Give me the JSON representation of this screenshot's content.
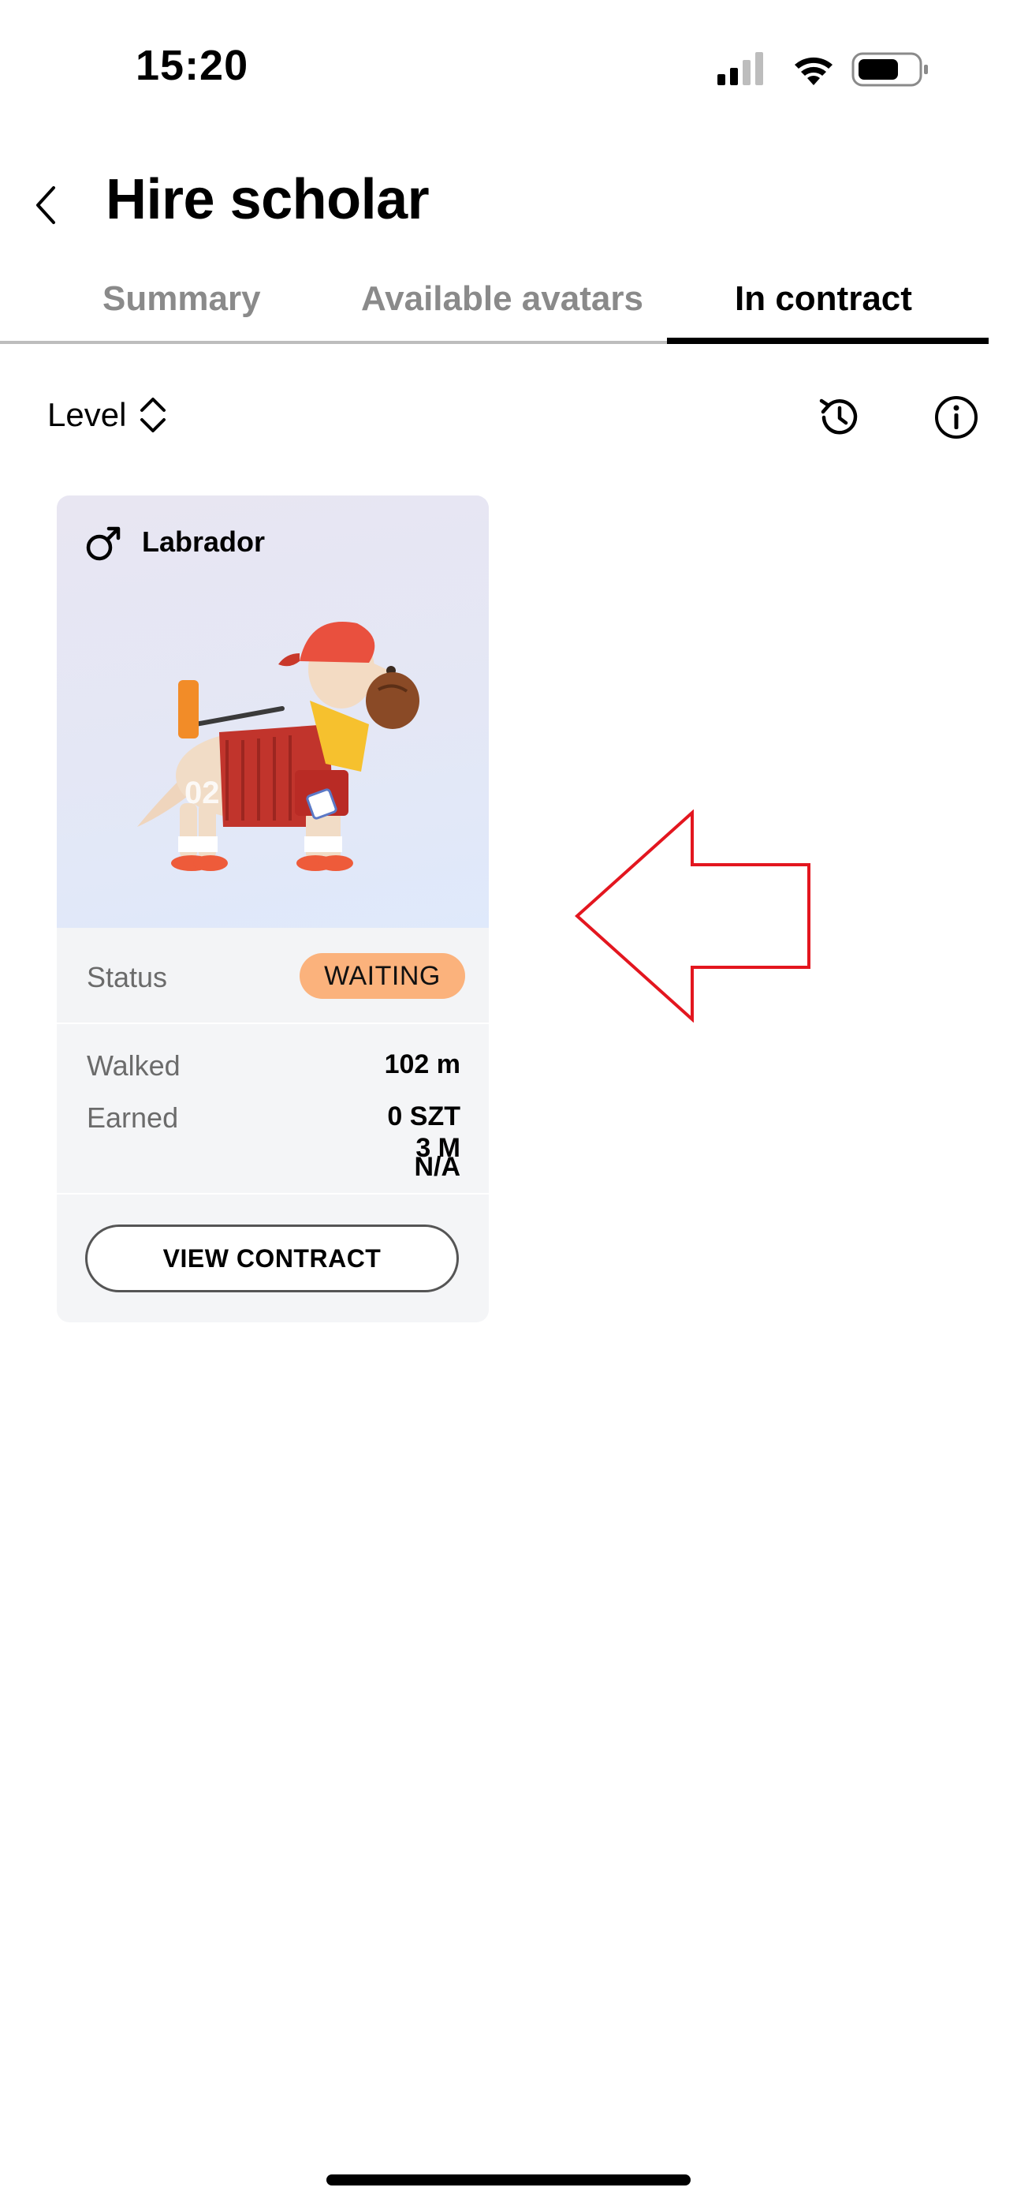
{
  "status_bar": {
    "time": "15:20"
  },
  "header": {
    "title": "Hire scholar"
  },
  "tabs": [
    {
      "label": "Summary"
    },
    {
      "label": "Available avatars"
    },
    {
      "label": "In contract"
    }
  ],
  "toolbar": {
    "sort_label": "Level"
  },
  "card": {
    "breed": "Labrador",
    "status_label": "Status",
    "status_value": "WAITING",
    "walked_label": "Walked",
    "walked_value": "102 m",
    "earned_label": "Earned",
    "earned_value": "0 SZT",
    "earned_time": "3 M",
    "earned_na": "N/A",
    "button_label": "VIEW CONTRACT"
  },
  "colors": {
    "accent": "#000000",
    "status_badge": "#fbb27c",
    "annotation_arrow": "#e3161f"
  },
  "icons": {
    "back": "chevron-left-icon",
    "sort": "sort-updown-icon",
    "history": "history-clock-icon",
    "info": "info-circle-icon",
    "gender": "male-icon"
  }
}
